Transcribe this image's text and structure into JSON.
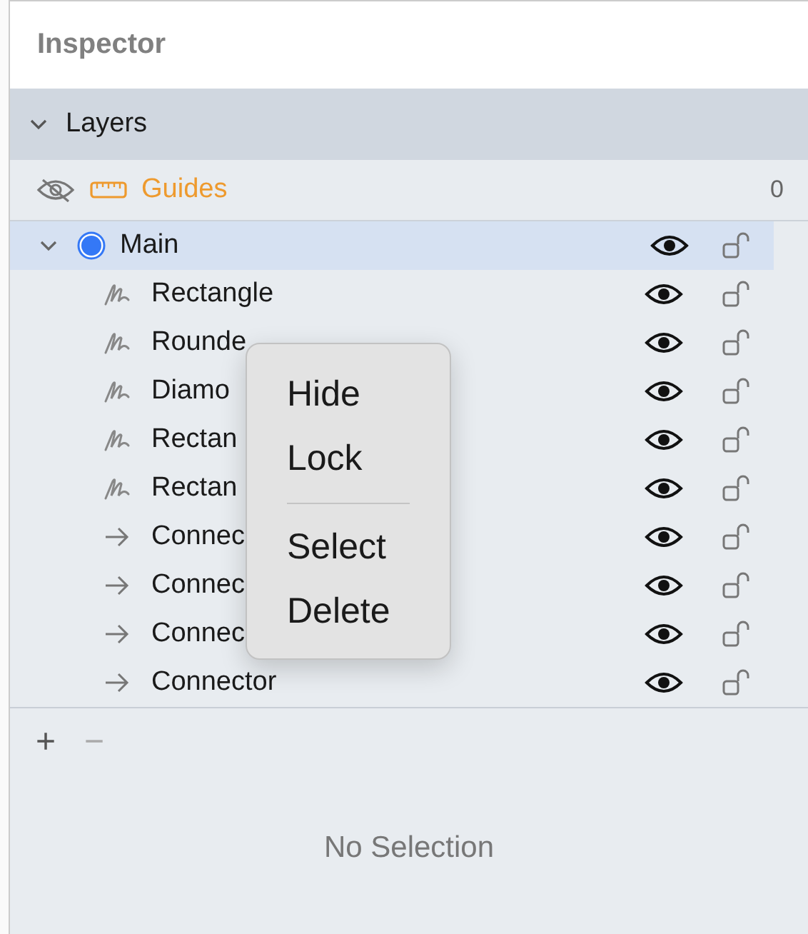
{
  "panel": {
    "title": "Inspector"
  },
  "section": {
    "title": "Layers",
    "expanded": true
  },
  "guides": {
    "label": "Guides",
    "visible": false,
    "count": "0"
  },
  "layer": {
    "name": "Main",
    "expanded": true,
    "selected": true,
    "color": "#3478f6",
    "visible": true,
    "locked": false,
    "children": [
      {
        "name": "Rectangle",
        "kind": "shape",
        "visible": true,
        "locked": false
      },
      {
        "name": "Rounde",
        "kind": "shape",
        "visible": true,
        "locked": false
      },
      {
        "name": "Diamo",
        "kind": "shape",
        "visible": true,
        "locked": false
      },
      {
        "name": "Rectan",
        "kind": "shape",
        "visible": true,
        "locked": false
      },
      {
        "name": "Rectan",
        "kind": "shape",
        "visible": true,
        "locked": false
      },
      {
        "name": "Connec",
        "kind": "connector",
        "visible": true,
        "locked": false
      },
      {
        "name": "Connec",
        "kind": "connector",
        "visible": true,
        "locked": false
      },
      {
        "name": "Connec",
        "kind": "connector",
        "visible": true,
        "locked": false
      },
      {
        "name": "Connector",
        "kind": "connector",
        "visible": true,
        "locked": false
      }
    ]
  },
  "context_menu": [
    {
      "kind": "item",
      "label": "Hide"
    },
    {
      "kind": "item",
      "label": "Lock"
    },
    {
      "kind": "separator"
    },
    {
      "kind": "item",
      "label": "Select"
    },
    {
      "kind": "item",
      "label": "Delete"
    }
  ],
  "footer": {
    "add": "+",
    "remove": "−",
    "empty_text": "No Selection"
  }
}
